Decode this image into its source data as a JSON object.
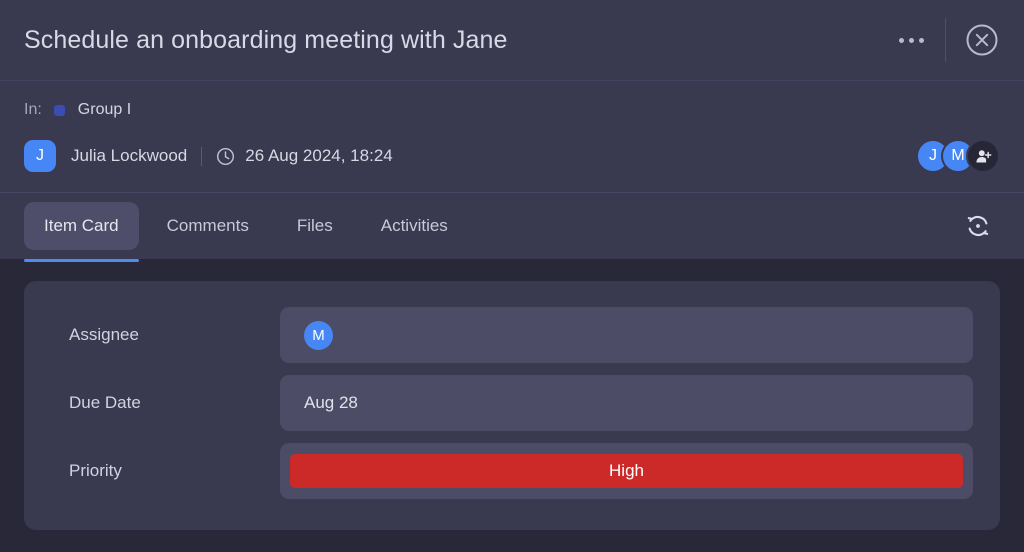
{
  "header": {
    "title": "Schedule an onboarding meeting with Jane",
    "more_label": "…",
    "close_label": "✕"
  },
  "meta": {
    "in_label": "In:",
    "group_name": "Group I",
    "author_initial": "J",
    "author_name": "Julia Lockwood",
    "separator": "|",
    "timestamp": "26 Aug 2024, 18:24",
    "participants": [
      {
        "initial": "J",
        "type": "user"
      },
      {
        "initial": "M",
        "type": "user"
      },
      {
        "initial": "",
        "type": "add-person"
      }
    ]
  },
  "tabs": [
    {
      "label": "Item Card",
      "active": true
    },
    {
      "label": "Comments",
      "active": false
    },
    {
      "label": "Files",
      "active": false
    },
    {
      "label": "Activities",
      "active": false
    }
  ],
  "toolbar": {
    "refresh_label": "Refresh"
  },
  "fields": [
    {
      "label": "Assignee",
      "value": "M",
      "kind": "avatar"
    },
    {
      "label": "Due Date",
      "value": "Aug 28",
      "kind": "text"
    },
    {
      "label": "Priority",
      "value": "High",
      "kind": "badge",
      "color": "#cc2a28"
    }
  ],
  "colors": {
    "page_background": "#282838",
    "panel_background": "#393950",
    "field_background": "#4c4c66",
    "accent_blue": "#4f8cf0",
    "avatar_blue": "#4787f5",
    "group_dot": "#3c4cb5",
    "priority_high": "#cc2a28"
  }
}
